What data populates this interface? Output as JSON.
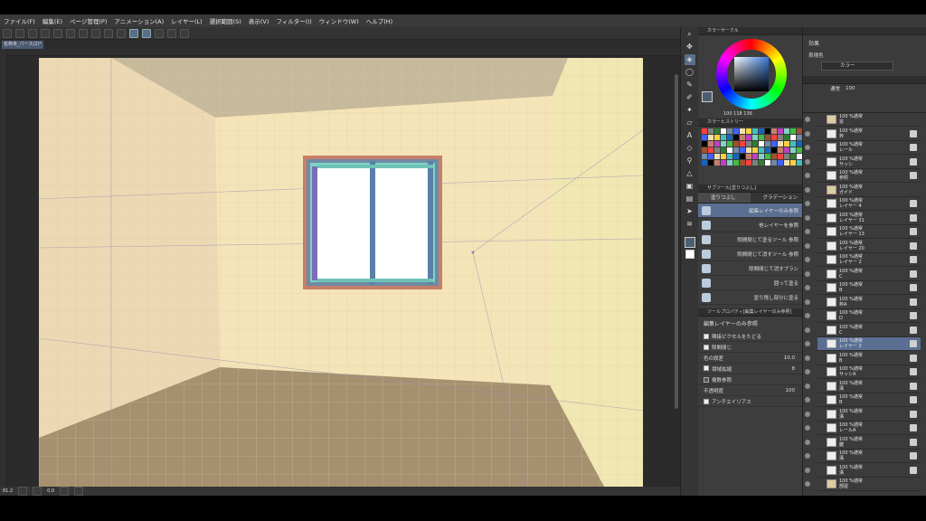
{
  "menu": [
    "ファイル(F)",
    "編集(E)",
    "ページ管理(P)",
    "アニメーション(A)",
    "レイヤー(L)",
    "選択範囲(S)",
    "表示(V)",
    "フィルター(I)",
    "ウィンドウ(W)",
    "ヘルプ(H)"
  ],
  "doc_tab": "名称未_パース(2)*",
  "status": {
    "zoom": "81.2",
    "angle": "0.0"
  },
  "color_wheel": {
    "title": "カラーサークル",
    "values": "100  118  136",
    "main_color": "#4b5e73"
  },
  "color_history": {
    "title": "カラーヒストリー"
  },
  "sub_tool": {
    "header": "サブツール[塗りつぶし]",
    "tabs": [
      "塗りつぶし",
      "グラデーション"
    ],
    "items": [
      "編集レイヤーのみ参照",
      "他レイヤーを参照",
      "隙間閉じて塗るツール 参照",
      "隙間閉じて消すツール 参照",
      "隙間閉じて消すブラシ",
      "囲って塗る",
      "塗り残し部分に塗る"
    ]
  },
  "tool_property": {
    "header": "ツールプロパティ[編集レイヤーのみ参照]",
    "title": "編集レイヤーのみ参照",
    "options": [
      {
        "label": "隣接ピクセルをたどる",
        "checked": true
      },
      {
        "label": "隙間閉じ",
        "checked": true
      },
      {
        "label": "色の誤差",
        "value": "10.0"
      },
      {
        "label": "領域拡縮",
        "checked": true,
        "value": "8"
      },
      {
        "label": "複数参照",
        "checked": false
      },
      {
        "label": "不透明度",
        "value": "100"
      },
      {
        "label": "アンチエイリアス",
        "checked": true
      }
    ]
  },
  "layer_panel": {
    "effect_title": "効果",
    "expression_color_label": "表現色",
    "expression_color": "カラー",
    "blend": "通常",
    "opacity": "100",
    "layers": [
      {
        "l1": "100 %通常",
        "l2": "窓",
        "type": "folder"
      },
      {
        "l1": "100 %通常",
        "l2": "枠",
        "type": "layer"
      },
      {
        "l1": "100 %通常",
        "l2": "レール",
        "type": "layer"
      },
      {
        "l1": "100 %通常",
        "l2": "サッシ",
        "type": "layer"
      },
      {
        "l1": "100 %通常",
        "l2": "参照",
        "type": "layer"
      },
      {
        "l1": "100 %通常",
        "l2": "ガイド",
        "type": "folder"
      },
      {
        "l1": "100 %通常",
        "l2": "レイヤー 4",
        "type": "layer"
      },
      {
        "l1": "100 %通常",
        "l2": "レイヤー 31",
        "type": "layer"
      },
      {
        "l1": "100 %通常",
        "l2": "レイヤー 13",
        "type": "layer"
      },
      {
        "l1": "100 %通常",
        "l2": "レイヤー 20",
        "type": "layer"
      },
      {
        "l1": "100 %通常",
        "l2": "レイヤー 2",
        "type": "layer"
      },
      {
        "l1": "100 %通常",
        "l2": "C",
        "type": "layer"
      },
      {
        "l1": "100 %通常",
        "l2": "B",
        "type": "layer"
      },
      {
        "l1": "100 %通常",
        "l2": "枠A",
        "type": "layer"
      },
      {
        "l1": "100 %通常",
        "l2": "D",
        "type": "layer"
      },
      {
        "l1": "100 %通常",
        "l2": "C",
        "type": "layer"
      },
      {
        "l1": "100 %通常",
        "l2": "レイヤー 3",
        "type": "layer",
        "selected": true
      },
      {
        "l1": "100 %通常",
        "l2": "B",
        "type": "layer"
      },
      {
        "l1": "100 %通常",
        "l2": "サッシA",
        "type": "layer"
      },
      {
        "l1": "100 %通常",
        "l2": "溝",
        "type": "layer"
      },
      {
        "l1": "100 %通常",
        "l2": "B",
        "type": "layer"
      },
      {
        "l1": "100 %通常",
        "l2": "溝",
        "type": "layer"
      },
      {
        "l1": "100 %通常",
        "l2": "レールA",
        "type": "layer"
      },
      {
        "l1": "100 %通常",
        "l2": "鍵",
        "type": "layer"
      },
      {
        "l1": "100 %通常",
        "l2": "溝",
        "type": "layer"
      },
      {
        "l1": "100 %通常",
        "l2": "溝",
        "type": "layer"
      },
      {
        "l1": "100 %通常",
        "l2": "部屋",
        "type": "folder"
      }
    ]
  }
}
